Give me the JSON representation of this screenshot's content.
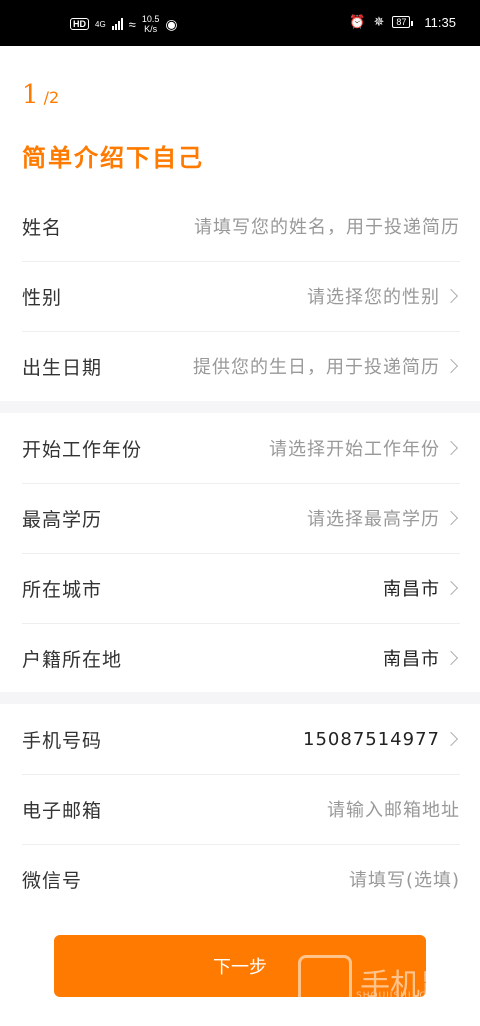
{
  "status": {
    "network": "4G",
    "speed": "10.5",
    "speed_unit": "K/s",
    "battery": "87",
    "time": "11:35"
  },
  "step": {
    "current": "1",
    "total": "/2"
  },
  "title": "简单介绍下自己",
  "fields": [
    {
      "label": "姓名",
      "value": "请填写您的姓名，用于投递简历",
      "filled": false,
      "chevron": false
    },
    {
      "label": "性别",
      "value": "请选择您的性别",
      "filled": false,
      "chevron": true
    },
    {
      "label": "出生日期",
      "value": "提供您的生日，用于投递简历",
      "filled": false,
      "chevron": true
    },
    {
      "label": "开始工作年份",
      "value": "请选择开始工作年份",
      "filled": false,
      "chevron": true
    },
    {
      "label": "最高学历",
      "value": "请选择最高学历",
      "filled": false,
      "chevron": true
    },
    {
      "label": "所在城市",
      "value": "南昌市",
      "filled": true,
      "chevron": true
    },
    {
      "label": "户籍所在地",
      "value": "南昌市",
      "filled": true,
      "chevron": true
    },
    {
      "label": "手机号码",
      "value": "15087514977",
      "filled": true,
      "chevron": true
    },
    {
      "label": "电子邮箱",
      "value": "请输入邮箱地址",
      "filled": false,
      "chevron": false
    },
    {
      "label": "微信号",
      "value": "请填写(选填)",
      "filled": false,
      "chevron": false
    }
  ],
  "next_button": "下一步",
  "watermark": {
    "text": "手机鼠",
    "sub": "SHOUJISHU.COM"
  },
  "colors": {
    "accent": "#ff7a00",
    "placeholder": "#999999",
    "filled": "#222222"
  }
}
